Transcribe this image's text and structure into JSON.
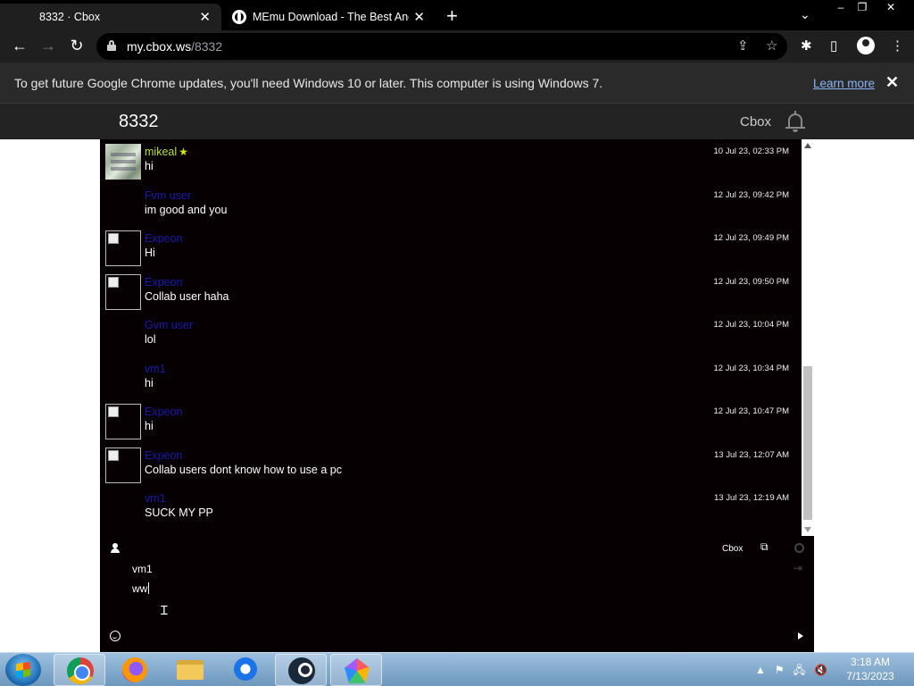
{
  "browser": {
    "tabs": [
      {
        "title": "8332 · Cbox",
        "active": true
      },
      {
        "title": "MEmu Download - The Best Andr",
        "active": false
      }
    ],
    "new_tab_icon": "plus-icon",
    "window_controls": {
      "minimize": "–",
      "restore": "❐",
      "close": "✕"
    },
    "tab_search": "⌄",
    "url": {
      "host": "my.cbox.ws",
      "path": "/8332"
    },
    "nav": {
      "back": "←",
      "forward": "→",
      "reload": "↻"
    },
    "toolbar_icons": {
      "share": "⇪",
      "bookmark": "☆",
      "extensions": "✱",
      "side_panel": "▯",
      "menu": "⋮"
    }
  },
  "infobar": {
    "message": "To get future Google Chrome updates, you'll need Windows 10 or later. This computer is using Windows 7.",
    "learn_more": "Learn more",
    "close": "✕"
  },
  "site": {
    "title": "8332",
    "brand": "Cbox"
  },
  "messages": [
    {
      "name": "mikeal",
      "starred": true,
      "text": "hi",
      "time": "10 Jul 23, 02:33 PM",
      "avatar": "photo"
    },
    {
      "name": "Fvm user",
      "starred": false,
      "text": "im good and you",
      "time": "12 Jul 23, 09:42 PM",
      "avatar": "none"
    },
    {
      "name": "Expeon",
      "starred": false,
      "text": "Hi",
      "time": "12 Jul 23, 09:49 PM",
      "avatar": "broken"
    },
    {
      "name": "Expeon",
      "starred": false,
      "text": "Collab user haha",
      "time": "12 Jul 23, 09:50 PM",
      "avatar": "broken"
    },
    {
      "name": "Gvm user",
      "starred": false,
      "text": "lol",
      "time": "12 Jul 23, 10:04 PM",
      "avatar": "none"
    },
    {
      "name": "vm1",
      "starred": false,
      "text": "hi",
      "time": "12 Jul 23, 10:34 PM",
      "avatar": "none"
    },
    {
      "name": "Expeon",
      "starred": false,
      "text": "hi",
      "time": "12 Jul 23, 10:47 PM",
      "avatar": "broken"
    },
    {
      "name": "Expeon",
      "starred": false,
      "text": "Collab users dont know how to use a pc",
      "time": "13 Jul 23, 12:07 AM",
      "avatar": "broken"
    },
    {
      "name": "vm1",
      "starred": false,
      "text": "SUCK MY PP",
      "time": "13 Jul 23, 12:19 AM",
      "avatar": "none"
    }
  ],
  "scroll": {
    "position": 1.0
  },
  "controls": {
    "cbox_link": "Cbox",
    "name_value": "vm1",
    "message_value": "ww"
  },
  "taskbar": {
    "apps": [
      "chrome",
      "firefox",
      "file-explorer",
      "thunderbird",
      "steam",
      "memu"
    ],
    "active_app": "chrome",
    "tray_icons": [
      "▲",
      "⚑",
      "🖧",
      "🔇"
    ],
    "time": "3:18 AM",
    "date": "7/13/2023"
  },
  "colors": {
    "chat_bg": "#060002",
    "name_color": "#1a1aa8",
    "first_name_color": "#b8e03a",
    "link_color": "#8ab4f8"
  }
}
